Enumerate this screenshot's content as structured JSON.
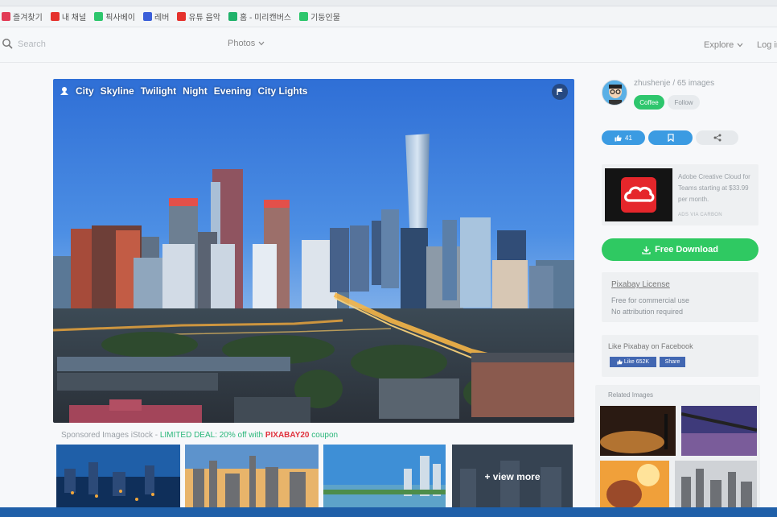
{
  "bookmarks": [
    {
      "label": "즐겨찾기",
      "color": "#e23b56"
    },
    {
      "label": "내 채널",
      "color": "#e5322d"
    },
    {
      "label": "픽사베이",
      "color": "#2ec66d"
    },
    {
      "label": "레버",
      "color": "#3b5fd9"
    },
    {
      "label": "유튜 음악",
      "color": "#e5322d"
    },
    {
      "label": "홈 - 미리캔버스",
      "color": "#20b26b"
    },
    {
      "label": "기둥인물",
      "color": "#2ec66d"
    }
  ],
  "header": {
    "search_placeholder": "Search",
    "photos_label": "Photos",
    "explore_label": "Explore",
    "login_label": "Log in"
  },
  "photo": {
    "tags": [
      "City",
      "Skyline",
      "Twilight",
      "Night",
      "Evening",
      "City Lights"
    ]
  },
  "sponsored": {
    "prefix": "Sponsored Images iStock - ",
    "deal": "LIMITED DEAL: 20% off with ",
    "code": "PIXABAY20",
    "suffix": " coupon"
  },
  "thumbs": {
    "view_more": "+ view more"
  },
  "author": {
    "name_line": "zhushenje / 65 images",
    "coffee_label": "Coffee",
    "follow_label": "Follow"
  },
  "actions": {
    "like_count": "41"
  },
  "ad": {
    "text": "Adobe Creative Cloud for Teams starting at $33.99 per month.",
    "via": "ADS VIA CARBON"
  },
  "download": {
    "label": "Free Download"
  },
  "license": {
    "title": "Pixabay License",
    "line1": "Free for commercial use",
    "line2": "No attribution required"
  },
  "facebook": {
    "title": "Like Pixabay on Facebook",
    "like_label": "Like 652K",
    "share_label": "Share"
  },
  "related": {
    "title": "Related Images"
  },
  "colors": {
    "accent_green": "#2fc962",
    "accent_blue": "#3b9be2",
    "deal_green": "#2ab77a",
    "coupon_red": "#e0323d",
    "facebook_blue": "#4267b2"
  }
}
